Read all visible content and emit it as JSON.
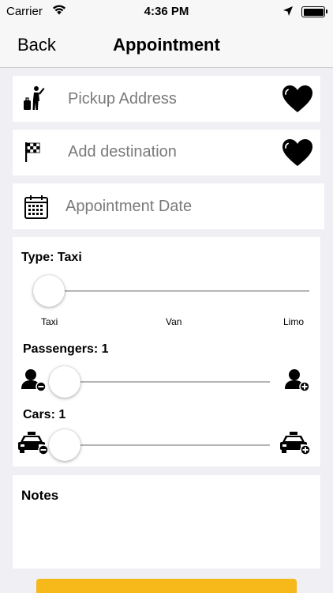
{
  "status_bar": {
    "carrier": "Carrier",
    "time": "4:36 PM"
  },
  "nav": {
    "back_label": "Back",
    "title": "Appointment"
  },
  "fields": {
    "pickup_placeholder": "Pickup Address",
    "destination_placeholder": "Add destination",
    "date_placeholder": "Appointment Date"
  },
  "type_slider": {
    "label": "Type: Taxi",
    "ticks": [
      "Taxi",
      "Van",
      "Limo"
    ],
    "value_fraction": 0
  },
  "passengers_slider": {
    "label": "Passengers: 1",
    "value_fraction": 0
  },
  "cars_slider": {
    "label": "Cars: 1",
    "value_fraction": 0
  },
  "notes": {
    "label": "Notes",
    "value": ""
  },
  "icons": {
    "status": [
      "wifi-icon",
      "location-arrow-icon",
      "battery-icon"
    ],
    "pickup": "person-luggage-icon",
    "destination": "checkered-flag-icon",
    "date": "calendar-icon",
    "favorite": "heart-icon",
    "passenger_minus": "person-minus-icon",
    "passenger_plus": "person-plus-icon",
    "car_minus": "taxi-minus-icon",
    "car_plus": "taxi-plus-icon"
  },
  "colors": {
    "background": "#efeff4",
    "submit_accent": "#f7b91a",
    "slider_track": "#b5b5b5"
  }
}
